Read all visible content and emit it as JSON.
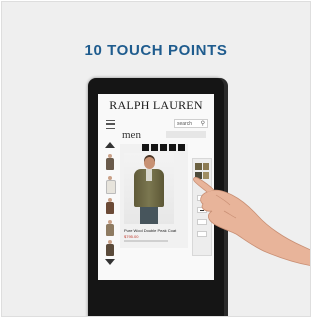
{
  "headline": "10 TOUCH POINTS",
  "kiosk": {
    "brand": "RALPH LAUREN",
    "search_label": "search",
    "category": "men",
    "product_title": "Pure Wool Double Peak Coat",
    "product_price": "$795.00"
  },
  "icons": [
    "menu-icon",
    "search-icon",
    "back-arrow-icon",
    "scroll-up-icon",
    "scroll-down-icon"
  ],
  "colors": {
    "accent": "#1f5c8e",
    "card_background": "#efefef",
    "kiosk_frame": "#151515"
  }
}
